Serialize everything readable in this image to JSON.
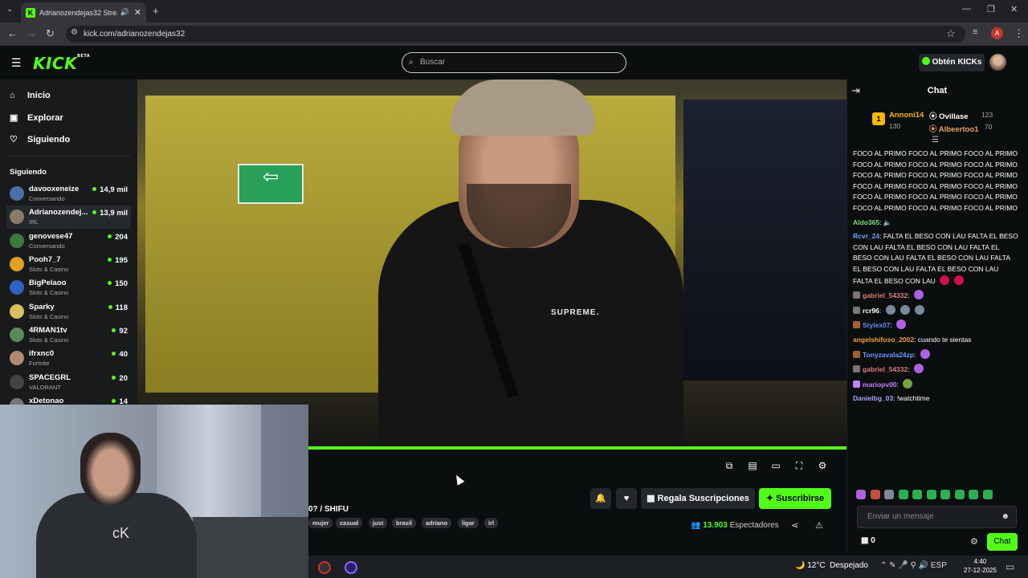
{
  "browser": {
    "tab_title": "Adrianozendejas32 Stream",
    "tab_logo": "K",
    "url": "kick.com/adrianozendejas32",
    "profile_initial": "A"
  },
  "header": {
    "logo": "KICK",
    "logo_badge": "BETA",
    "search_placeholder": "Buscar",
    "get_kicks_label": "Obtén KICKs"
  },
  "sidebar": {
    "nav": [
      {
        "label": "Inicio",
        "icon": "home-icon"
      },
      {
        "label": "Explorar",
        "icon": "compass-icon"
      },
      {
        "label": "Siguiendo",
        "icon": "heart-icon"
      }
    ],
    "following_heading": "Siguiendo",
    "following": [
      {
        "name": "davooxeneize",
        "category": "Conversando",
        "viewers": "14,9 mil",
        "color": "#4a6fa5"
      },
      {
        "name": "Adrianozendej...",
        "category": "IRL",
        "viewers": "13,9 mil",
        "color": "#8a7a6a"
      },
      {
        "name": "genovese47",
        "category": "Conversando",
        "viewers": "204",
        "color": "#3a7a3a"
      },
      {
        "name": "Pooh7_7",
        "category": "Slots & Casino",
        "viewers": "195",
        "color": "#e0a020"
      },
      {
        "name": "BigPelaoo",
        "category": "Slots & Casino",
        "viewers": "150",
        "color": "#3060c0"
      },
      {
        "name": "Sparky",
        "category": "Slots & Casino",
        "viewers": "118",
        "color": "#d8c060"
      },
      {
        "name": "4RMAN1tv",
        "category": "Slots & Casino",
        "viewers": "92",
        "color": "#5a8a5a"
      },
      {
        "name": "ifrxnc0",
        "category": "Fortnite",
        "viewers": "40",
        "color": "#b08a70"
      },
      {
        "name": "SPACEGRL",
        "category": "VALORANT",
        "viewers": "20",
        "color": "#444"
      },
      {
        "name": "xDetonao",
        "category": "",
        "viewers": "14",
        "color": "#777"
      }
    ]
  },
  "video": {
    "shirt_text": "SUPREME."
  },
  "stream": {
    "title": "0? / SHIFU",
    "tags": [
      "mujer",
      "casual",
      "just",
      "brasil",
      "adriano",
      "ligar",
      "irl"
    ],
    "gift_label": "Regala Suscripciones",
    "subscribe_label": "Suscribirse",
    "viewer_count": "13.903",
    "viewer_label": "Espectadores"
  },
  "chat": {
    "title": "Chat",
    "leaderboard": [
      {
        "rank": "1",
        "name": "Annoni14",
        "amount": "130",
        "color": "#f5b800"
      },
      {
        "name": "Ovillase",
        "amount": "123",
        "color": "#ffffff"
      },
      {
        "name": "Albeertoo1",
        "amount": "70",
        "color": "#f0a060"
      }
    ],
    "messages": [
      {
        "user": "",
        "color": "#fff",
        "text": "FOCO AL PRIMO FOCO AL PRIMO FOCO AL PRIMO FOCO AL PRIMO FOCO AL PRIMO FOCO AL PRIMO FOCO AL PRIMO FOCO AL PRIMO FOCO AL PRIMO FOCO AL PRIMO FOCO AL PRIMO FOCO AL PRIMO FOCO AL PRIMO FOCO AL PRIMO FOCO AL PRIMO FOCO AL PRIMO FOCO AL PRIMO FOCO AL PRIMO"
      },
      {
        "user": "Aldo365",
        "color": "#7de07d",
        "text": ""
      },
      {
        "user": "Rcvr_24",
        "color": "#6aa6ff",
        "text": "FALTA EL BESO CON LAU FALTA EL BESO CON LAU FALTA EL BESO CON LAU FALTA EL BESO CON LAU FALTA EL BESO CON LAU FALTA EL BESO CON LAU FALTA EL BESO CON LAU FALTA EL BESO CON LAU"
      },
      {
        "user": "gabriel_54332",
        "color": "#e07a7a",
        "text": ""
      },
      {
        "user": "rcr96",
        "color": "#ffffff",
        "text": ""
      },
      {
        "user": "Stylex07",
        "color": "#6a8aff",
        "text": ""
      },
      {
        "user": "angelshifoso_2002",
        "color": "#f0a040",
        "text": "cuando te sientas"
      },
      {
        "user": "Tonyzavala24zp",
        "color": "#6a9aff",
        "text": ""
      },
      {
        "user": "gabriel_54332",
        "color": "#e07a7a",
        "text": ""
      },
      {
        "user": "mariopv00",
        "color": "#c080ff",
        "text": ""
      },
      {
        "user": "Danielbg_03",
        "color": "#b0a0ff",
        "text": "!watchtime"
      }
    ],
    "input_placeholder": "Enviar un mensaje",
    "kicks_balance": "0",
    "send_label": "Chat"
  },
  "taskbar": {
    "temperature": "12°C",
    "weather": "Despejado",
    "language": "ESP",
    "time": "4:40",
    "date": "27-12-2025"
  },
  "colors": {
    "accent": "#53fc18"
  }
}
